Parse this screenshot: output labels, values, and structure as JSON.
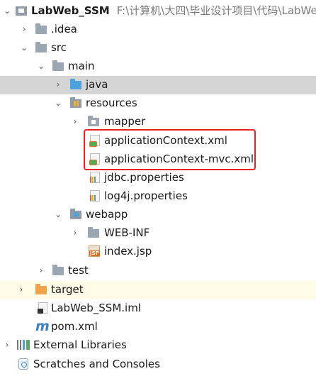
{
  "tree": {
    "root": {
      "name": "LabWeb_SSM",
      "path": "F:\\计算机\\大四\\毕业设计项目\\代码\\LabWeb"
    },
    "idea": ".idea",
    "src": "src",
    "main": "main",
    "java": "java",
    "resources": "resources",
    "mapper": "mapper",
    "app_ctx": "applicationContext.xml",
    "app_ctx_mvc": "applicationContext-mvc.xml",
    "jdbc": "jdbc.properties",
    "log4j": "log4j.properties",
    "webapp": "webapp",
    "webinf": "WEB-INF",
    "index": "index.jsp",
    "test": "test",
    "target": "target",
    "iml": "LabWeb_SSM.iml",
    "pom_glyph": "m",
    "pom": "pom.xml",
    "ext_libs": "External Libraries",
    "scratches": "Scratches and Consoles"
  },
  "icons": {
    "jsp_badge": "JSP"
  },
  "colors": {
    "selection": "#d5d5d5",
    "highlight_border": "#e82222",
    "folder_blue": "#4aa3df",
    "folder_orange": "#f0a34a"
  }
}
